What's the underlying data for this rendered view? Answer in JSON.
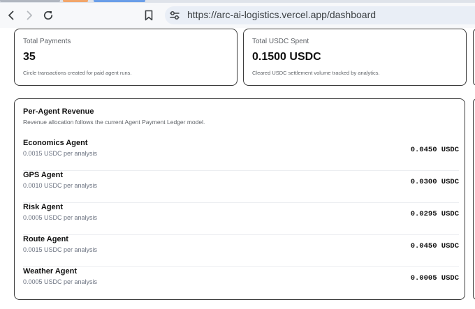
{
  "browser": {
    "url": "https://arc-ai-logistics.vercel.app/dashboard",
    "tab_colors": [
      "#b0b6c0",
      "#f2a66a",
      "#6a9ee8"
    ]
  },
  "stats": [
    {
      "label": "Total Payments",
      "value": "35",
      "description": "Circle transactions created for paid agent runs."
    },
    {
      "label": "Total USDC Spent",
      "value": "0.1500 USDC",
      "description": "Cleared USDC settlement volume tracked by analytics."
    }
  ],
  "revenue": {
    "title": "Per-Agent Revenue",
    "subtitle": "Revenue allocation follows the current Agent Payment Ledger model.",
    "agents": [
      {
        "name": "Economics Agent",
        "rate": "0.0015 USDC per analysis",
        "amount": "0.0450 USDC"
      },
      {
        "name": "GPS Agent",
        "rate": "0.0010 USDC per analysis",
        "amount": "0.0300 USDC"
      },
      {
        "name": "Risk Agent",
        "rate": "0.0005 USDC per analysis",
        "amount": "0.0295 USDC"
      },
      {
        "name": "Route Agent",
        "rate": "0.0015 USDC per analysis",
        "amount": "0.0450 USDC"
      },
      {
        "name": "Weather Agent",
        "rate": "0.0005 USDC per analysis",
        "amount": "0.0005 USDC"
      }
    ]
  }
}
